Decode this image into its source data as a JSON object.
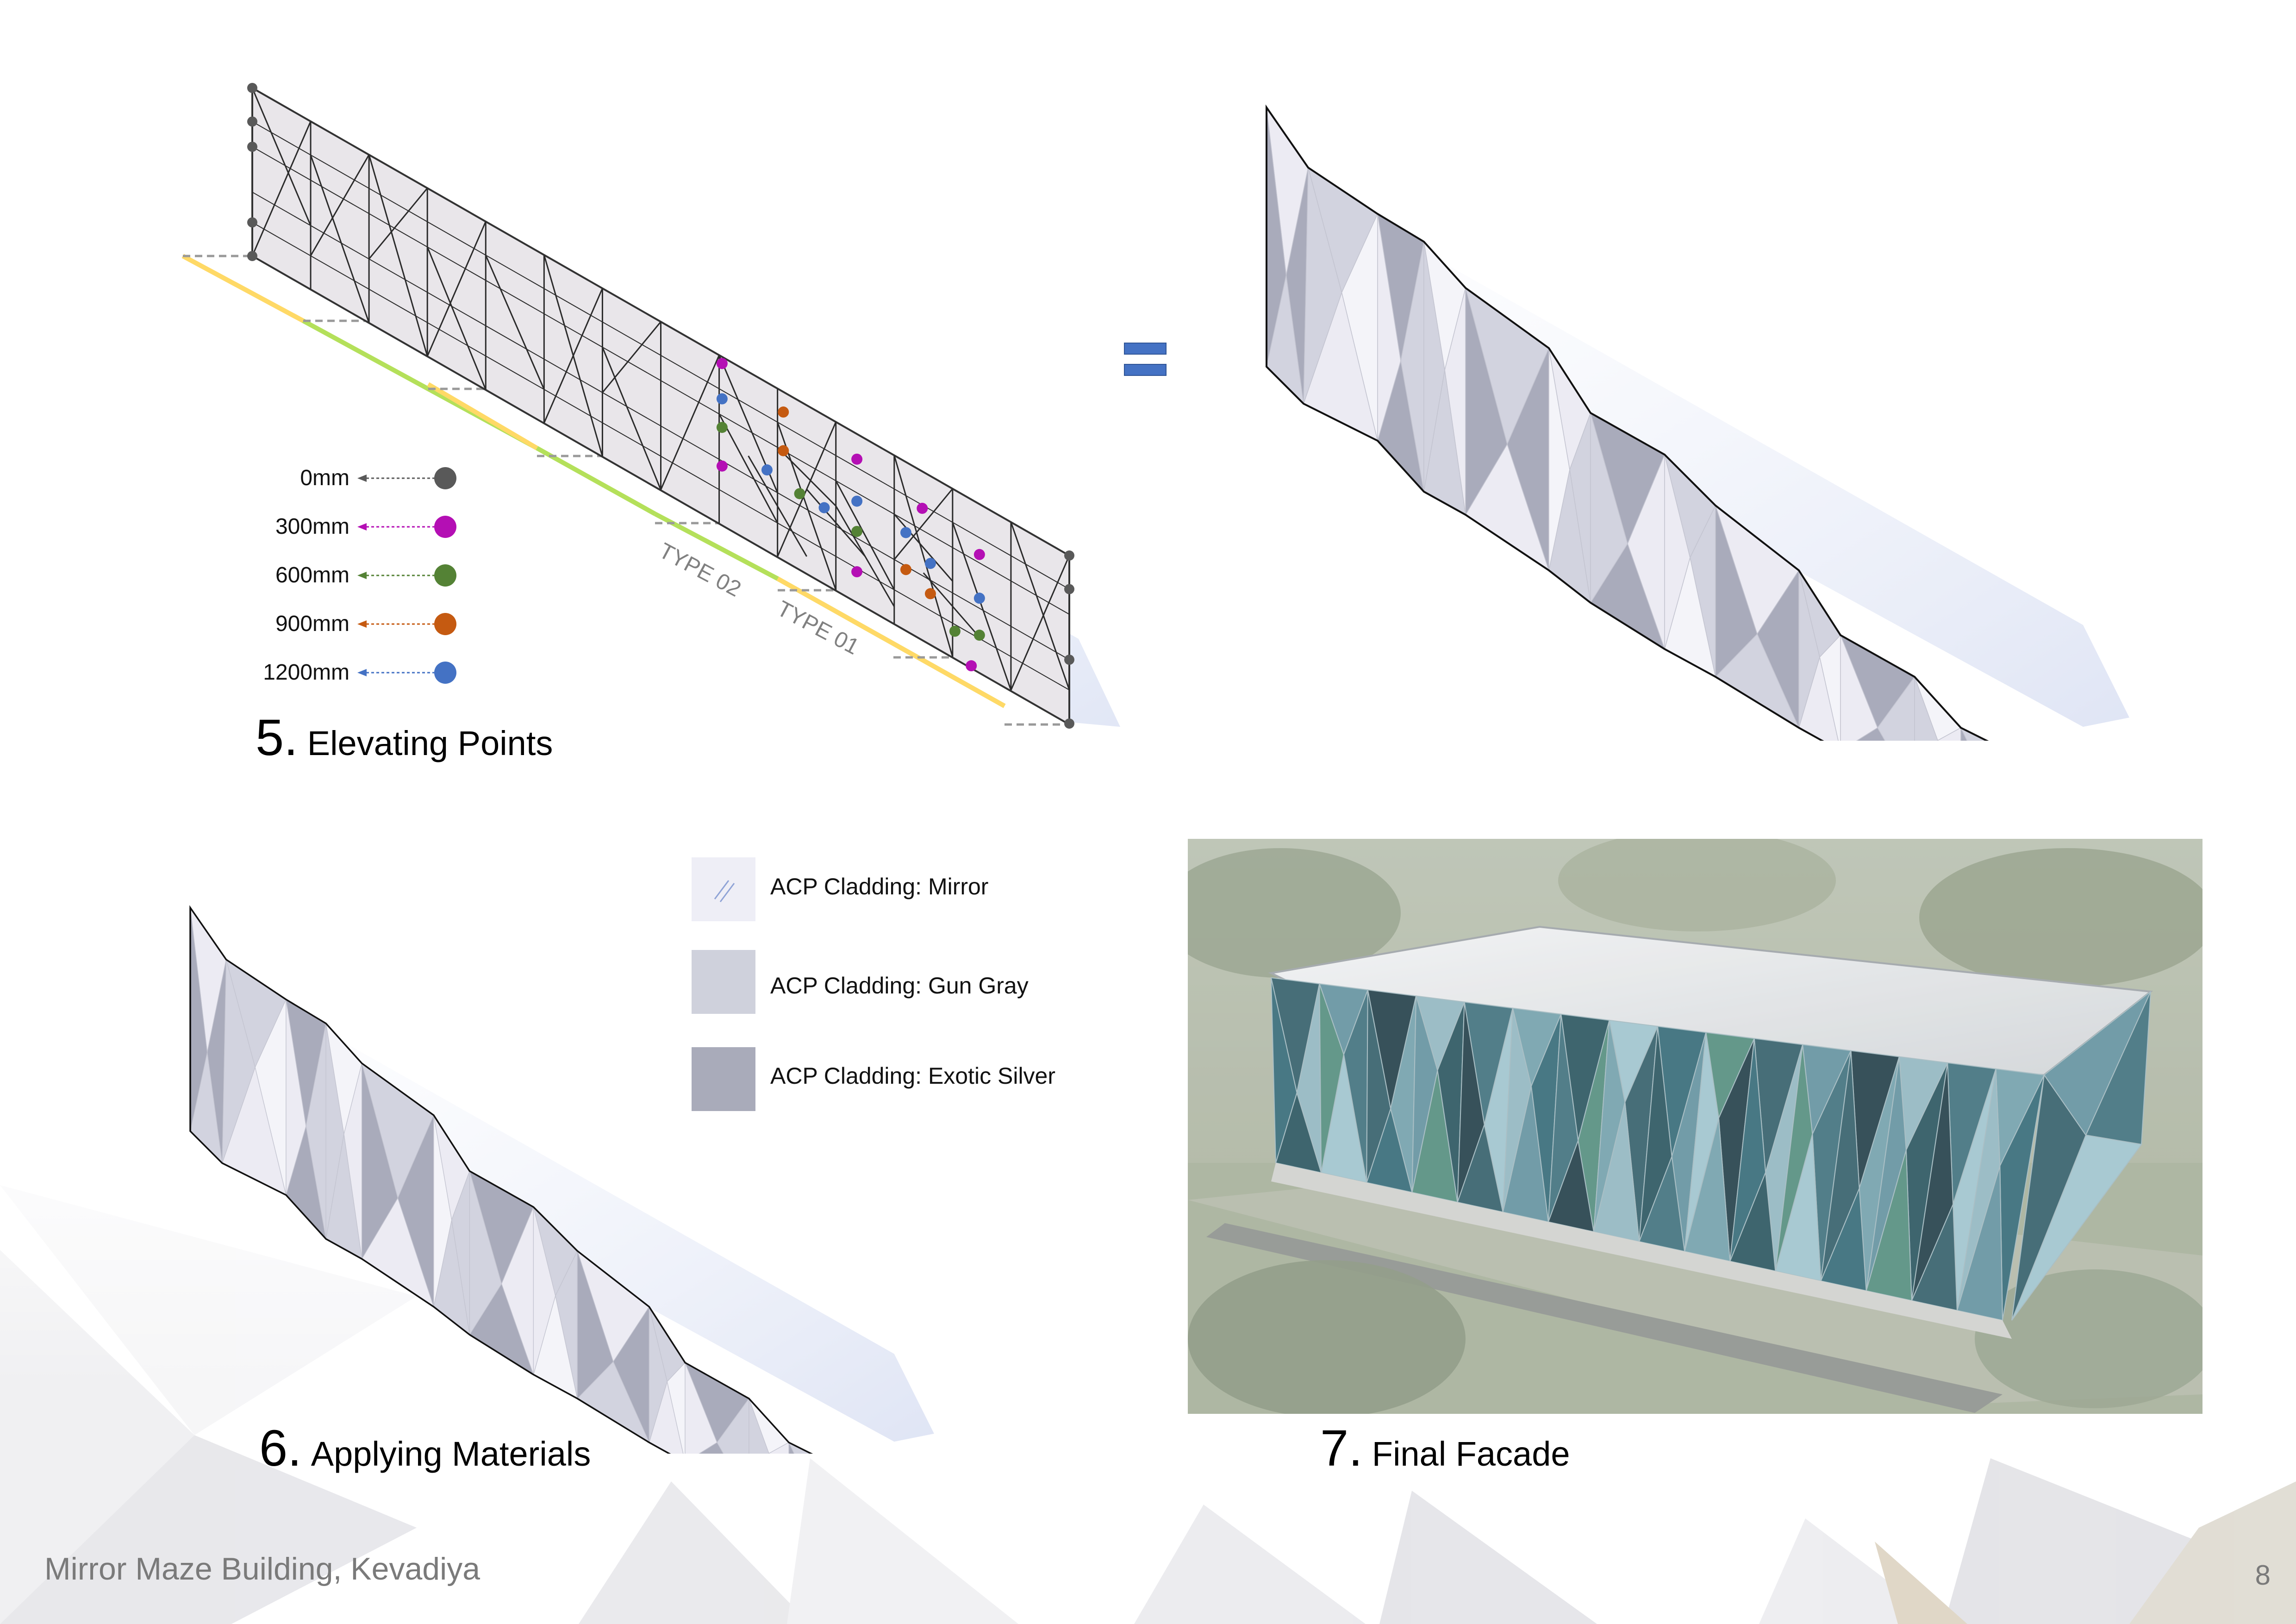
{
  "steps": {
    "elevating": {
      "number": "5.",
      "title": "Elevating Points"
    },
    "materials": {
      "number": "6.",
      "title": "Applying Materials"
    },
    "final": {
      "number": "7.",
      "title": "Final Facade"
    }
  },
  "height_legend": [
    {
      "label": "0mm",
      "color": "#595959"
    },
    {
      "label": "300mm",
      "color": "#b40fb4"
    },
    {
      "label": "600mm",
      "color": "#548235"
    },
    {
      "label": "900mm",
      "color": "#c55a11"
    },
    {
      "label": "1200mm",
      "color": "#4472c4"
    }
  ],
  "type_labels": {
    "type02": "TYPE 02",
    "type01": "TYPE 01"
  },
  "type_colors": {
    "type02": "#ffd966",
    "type01": "#b4e05a"
  },
  "materials": [
    {
      "label": "ACP Cladding: Mirror",
      "color": "#eeeef6"
    },
    {
      "label": "ACP Cladding: Gun Gray",
      "color": "#cfd1dc"
    },
    {
      "label": "ACP Cladding: Exotic Silver",
      "color": "#a9abba"
    }
  ],
  "footer": {
    "title": "Mirror Maze Building, Kevadiya",
    "page_number": "8"
  }
}
